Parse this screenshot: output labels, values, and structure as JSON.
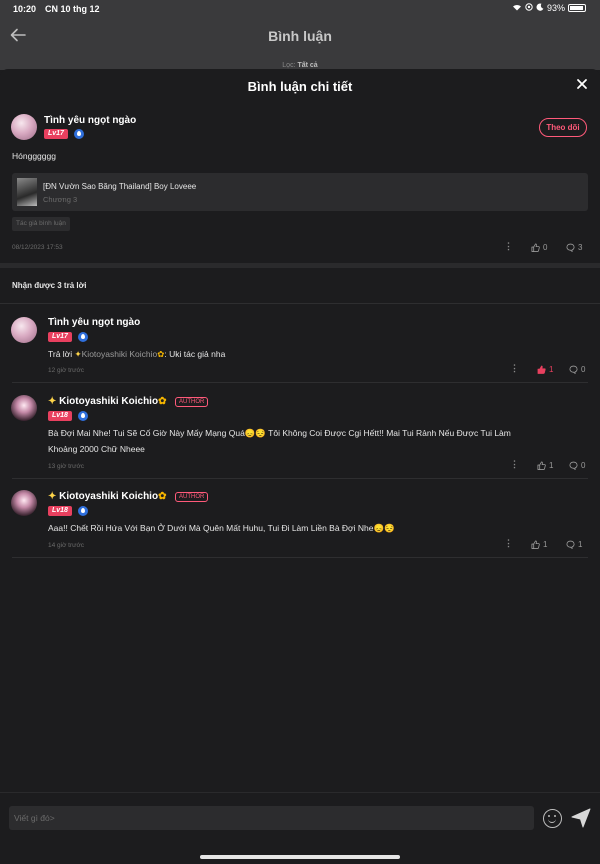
{
  "status_bar": {
    "time": "10:20",
    "date": "CN 10 thg 12",
    "battery": "93%"
  },
  "background_header": {
    "title": "Bình luận",
    "filter_label": "Lọc:",
    "filter_value": "Tất cả"
  },
  "sheet": {
    "title": "Bình luận chi tiết"
  },
  "main_comment": {
    "author": "Tình yêu ngọt ngào",
    "level": "Lv17",
    "follow_label": "Theo dõi",
    "content": "Hóngggggg",
    "story_title": "[ĐN Vườn Sao Băng Thailand] Boy Loveee",
    "story_chapter": "Chương 3",
    "author_chip": "Tác giả bình luận",
    "timestamp": "08/12/2023 17:53",
    "likes": "0",
    "replies": "3"
  },
  "replies_header": "Nhận được 3 trả lời",
  "replies": [
    {
      "author": "Tình yêu ngọt ngào",
      "level": "Lv17",
      "prefix": "Trả lời ",
      "mention": "Kiotoyashiki Koichio",
      "content": ": Uki tác giả nha",
      "time": "12 giờ trước",
      "likes": "1",
      "comments": "0"
    },
    {
      "author": "Kiotoyashiki Koichio",
      "level": "Lv18",
      "author_tag": "AUTHOR",
      "content_line1": "Bà Đợi Mai Nhe! Tui Sẽ Cố Giờ Này Mấy Mạng Quá😞😔 Tôi Không Coi Được Cgi Hếtt!! Mai Tui Rảnh Nếu Được Tui Làm",
      "content_line2": "Khoảng 2000 Chữ Nheee",
      "time": "13 giờ trước",
      "likes": "1",
      "comments": "0"
    },
    {
      "author": "Kiotoyashiki Koichio",
      "level": "Lv18",
      "author_tag": "AUTHOR",
      "content_line1": "Aaa!! Chết Rồi Hứa Với Bạn Ở Dưới Mà Quên Mất Huhu, Tui Đi Làm Liền Bà Đợi Nhe😞😔",
      "time": "14 giờ trước",
      "likes": "1",
      "comments": "1"
    }
  ],
  "input": {
    "placeholder": "Viết gì đó>"
  },
  "colors": {
    "accent": "#ff5a7a",
    "level_badge": "#e8405f",
    "background": "#1c1c1e",
    "card": "#2c2c2e"
  }
}
